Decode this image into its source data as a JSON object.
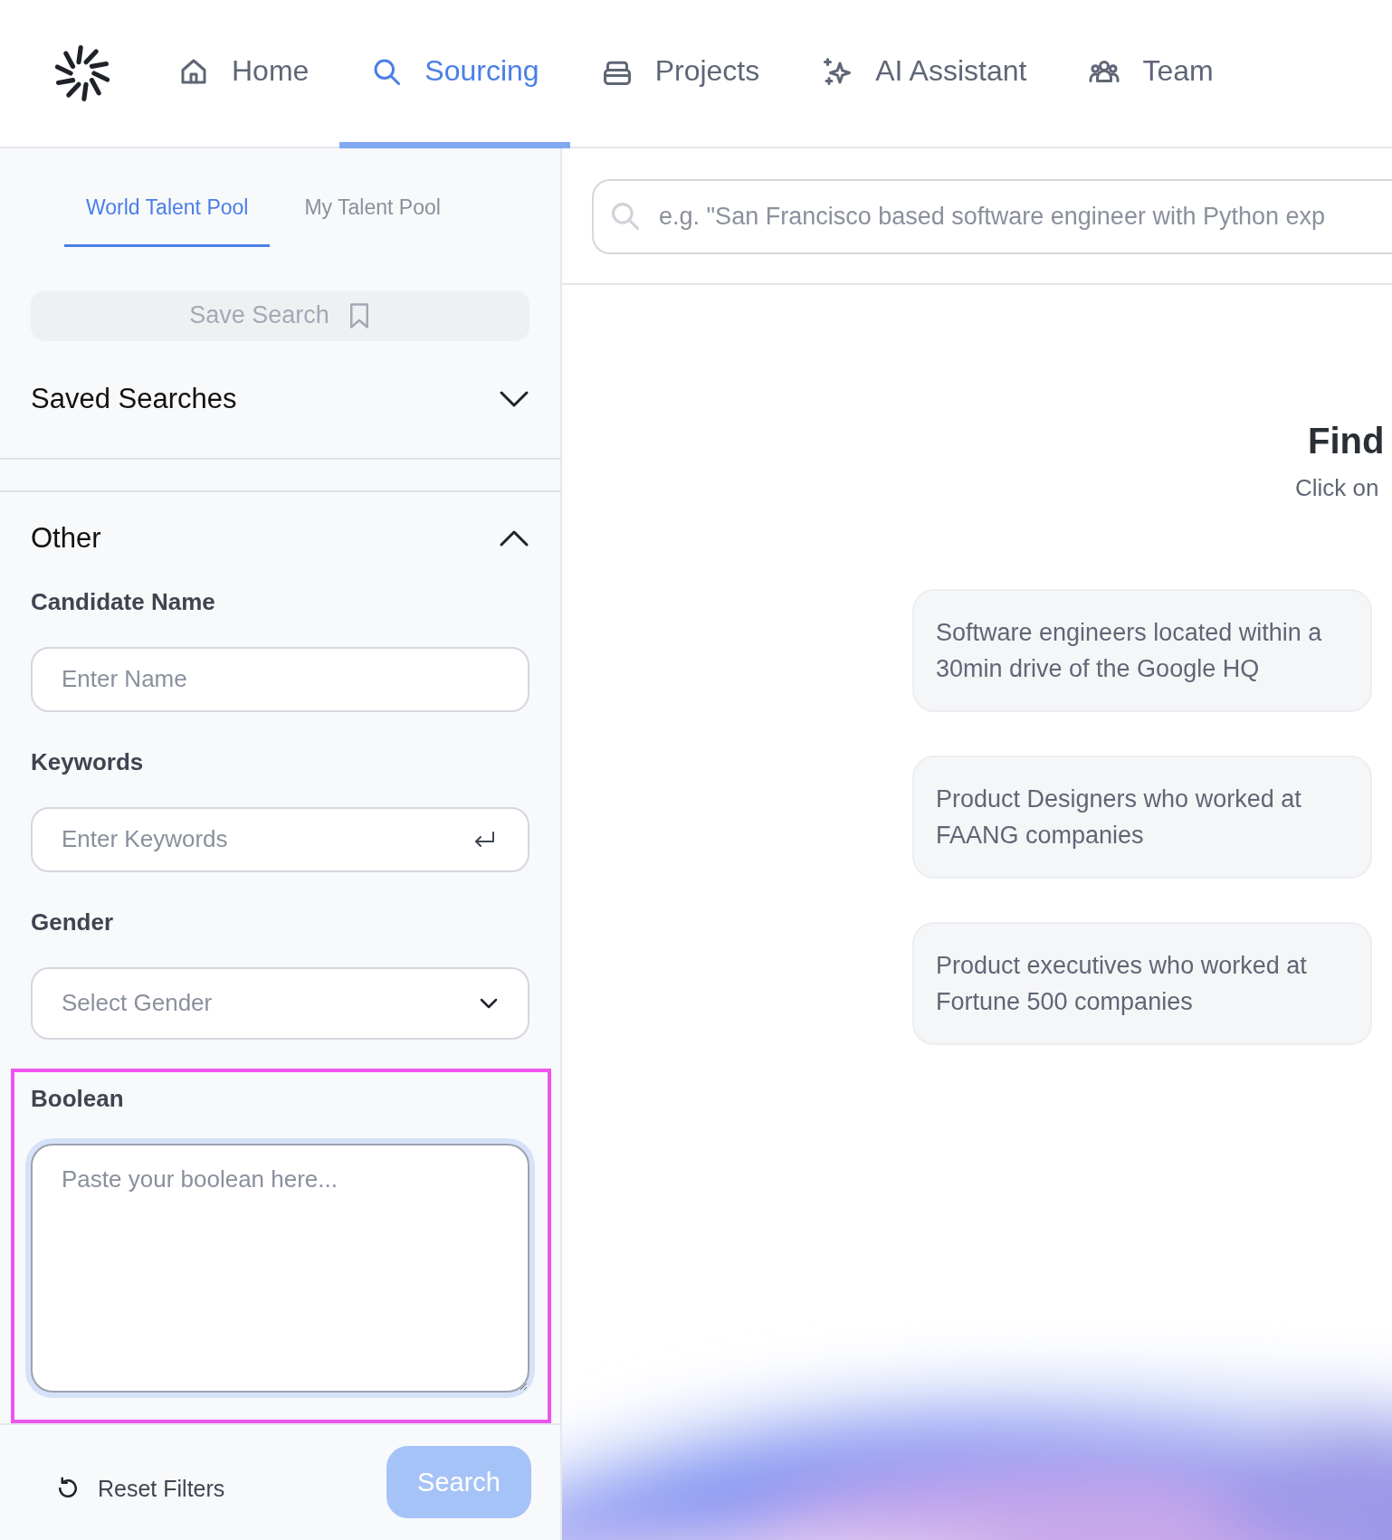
{
  "nav": {
    "items": [
      {
        "label": "Home",
        "selected": false
      },
      {
        "label": "Sourcing",
        "selected": true
      },
      {
        "label": "Projects",
        "selected": false
      },
      {
        "label": "AI Assistant",
        "selected": false
      },
      {
        "label": "Team",
        "selected": false
      }
    ]
  },
  "sidebar": {
    "pool_tabs": [
      {
        "label": "World Talent Pool",
        "selected": true
      },
      {
        "label": "My Talent Pool",
        "selected": false
      }
    ],
    "save_search_button": {
      "label": "Save Search",
      "disabled": true
    },
    "sections": [
      {
        "title": "Saved Searches",
        "expanded": false
      },
      {
        "title": "Other",
        "expanded": true,
        "fields": [
          {
            "kind": "text",
            "label": "Candidate Name",
            "placeholder": "Enter Name",
            "focused": false,
            "highlighted": false
          },
          {
            "kind": "keywords",
            "label": "Keywords",
            "placeholder": "Enter Keywords",
            "focused": false,
            "highlighted": false
          },
          {
            "kind": "select",
            "label": "Gender",
            "placeholder": "Select Gender",
            "focused": false,
            "highlighted": false
          },
          {
            "kind": "textarea",
            "label": "Boolean",
            "placeholder": "Paste your boolean here...",
            "focused": true,
            "highlighted": true
          }
        ]
      }
    ],
    "footer": {
      "reset_label": "Reset Filters",
      "search_button": {
        "label": "Search",
        "disabled": true
      }
    }
  },
  "main": {
    "search": {
      "placeholder": "e.g. \"San Francisco based software engineer with Python exp"
    },
    "heading": "Find",
    "subheading": "Click on",
    "suggestions": [
      "Software engineers located within a 30min drive of the Google HQ",
      "Product Designers who worked at FAANG companies",
      "Product executives who worked at Fortune 500 companies"
    ]
  }
}
